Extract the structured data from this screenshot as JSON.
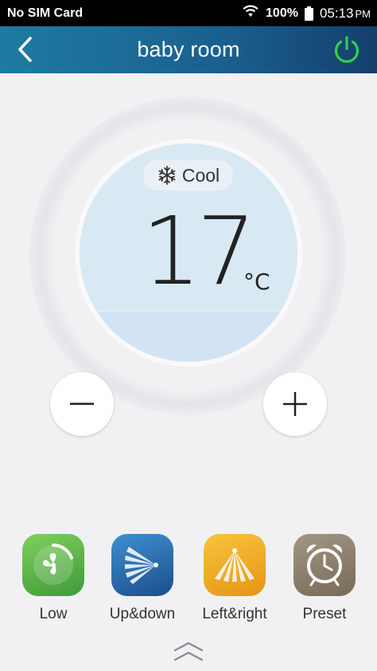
{
  "status_bar": {
    "carrier": "No SIM Card",
    "battery": "100%",
    "time": "05:13",
    "ampm": "PM",
    "icons": [
      "wifi-icon",
      "battery-icon"
    ]
  },
  "header": {
    "title": "baby room",
    "back_icon": "chevron-left-icon",
    "power_icon": "power-icon",
    "power_color": "#2fd14b"
  },
  "dial": {
    "mode_label": "Cool",
    "mode_icon": "snowflake-icon",
    "temperature": "17",
    "unit": "°C"
  },
  "buttons": {
    "decrease_icon": "minus-icon",
    "increase_icon": "plus-icon"
  },
  "controls": [
    {
      "label": "Low",
      "icon": "fan-icon",
      "color": "#5bb547"
    },
    {
      "label": "Up&down",
      "icon": "vertical-swing-icon",
      "color": "#2d6fb2"
    },
    {
      "label": "Left&right",
      "icon": "horizontal-swing-icon",
      "color": "#f0ab25"
    },
    {
      "label": "Preset",
      "icon": "alarm-clock-icon",
      "color": "#8d7f6c"
    }
  ],
  "footer": {
    "expand_icon": "double-chevron-up-icon"
  }
}
